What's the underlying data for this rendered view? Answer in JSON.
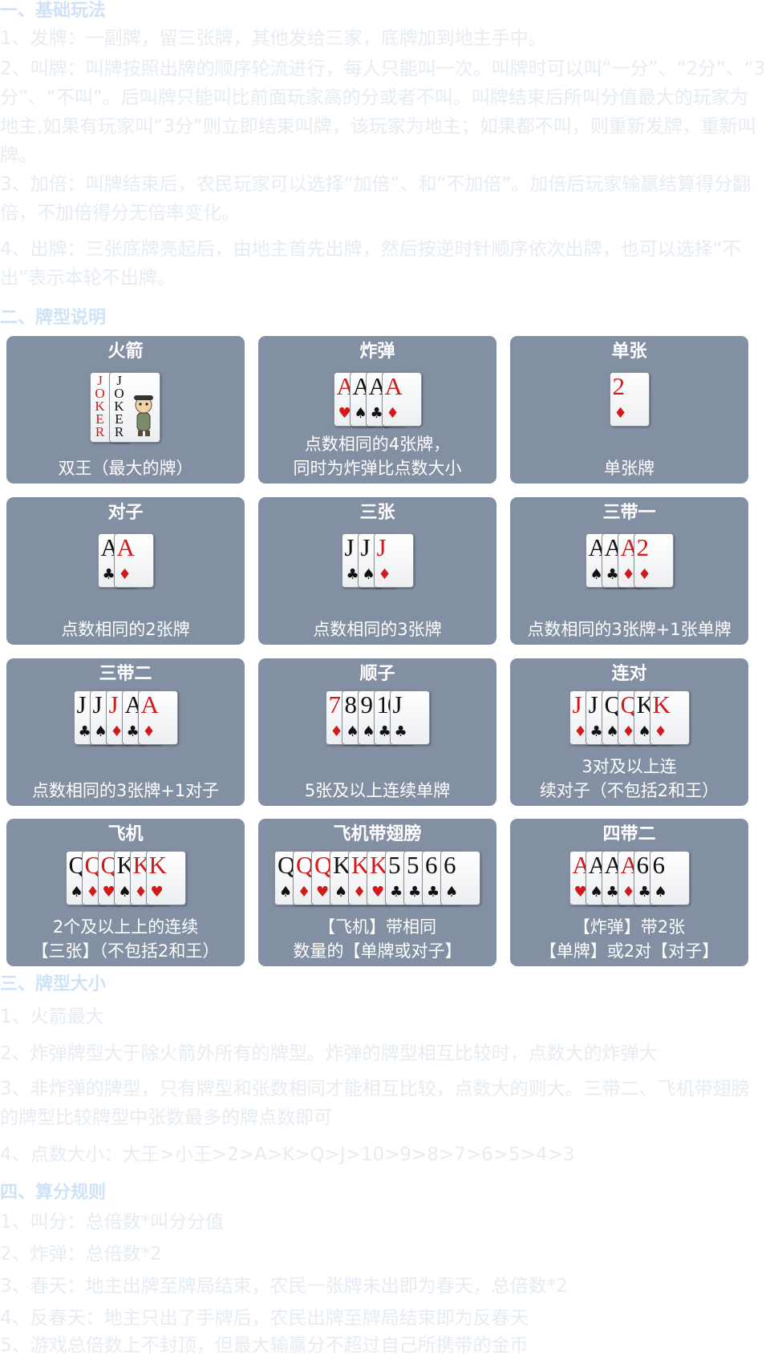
{
  "sections": {
    "s1": {
      "title": "一、基础玩法",
      "lines": [
        "1、发牌：一副牌，留三张牌，其他发给三家，底牌加到地主手中。",
        "2、叫牌：叫牌按照出牌的顺序轮流进行，每人只能叫一次。叫牌时可以叫“一分”、“2分”、“3分”、“不叫”。后叫牌只能叫比前面玩家高的分或者不叫。叫牌结束后所叫分值最大的玩家为地主,如果有玩家叫“3分”则立即结束叫牌，该玩家为地主；如果都不叫，则重新发牌，重新叫牌。",
        "3、加倍：叫牌结束后，农民玩家可以选择“加倍”、和“不加倍”。加倍后玩家输赢结算得分翻倍，不加倍得分无倍率变化。",
        "4、出牌：三张底牌亮起后，由地主首先出牌，然后按逆时针顺序依次出牌，也可以选择“不出”表示本轮不出牌。"
      ]
    },
    "s2": {
      "title": "二、牌型说明"
    },
    "s3": {
      "title": "三、牌型大小",
      "lines": [
        "1、火箭最大",
        "2、炸弹牌型大于除火箭外所有的牌型。炸弹的牌型相互比较时，点数大的炸弹大",
        "3、非炸弹的牌型，只有牌型和张数相同才能相互比较，点数大的则大。三带二、飞机带翅膀的牌型比较牌型中张数最多的牌点数即可",
        "4、点数大小：大王>小王>2>A>K>Q>J>10>9>8>7>6>5>4>3"
      ]
    },
    "s4": {
      "title": "四、算分规则",
      "lines": [
        "1、叫分：总倍数*叫分分值",
        "2、炸弹：总倍数*2",
        "3、春天：地主出牌至牌局结束，农民一张牌未出即为春天，总倍数*2",
        "4、反春天：地主只出了手牌后，农民出牌至牌局结束即为反春天",
        "5、游戏总倍数上不封顶，但最大输赢分不超过自己所携带的金币"
      ]
    }
  },
  "card_types": [
    {
      "name": "火箭",
      "desc": "双王（最大的牌）",
      "jokers": [
        {
          "text": "JOKER",
          "color": "red"
        },
        {
          "text": "JOKER",
          "color": "black"
        }
      ]
    },
    {
      "name": "炸弹",
      "desc": "点数相同的4张牌，\n同时为炸弹比点数大小",
      "cards": [
        [
          "A",
          "♥"
        ],
        [
          "A",
          "♠"
        ],
        [
          "A",
          "♣"
        ],
        [
          "A",
          "♦"
        ]
      ]
    },
    {
      "name": "单张",
      "desc": "单张牌",
      "cards": [
        [
          "2",
          "♦"
        ]
      ]
    },
    {
      "name": "对子",
      "desc": "点数相同的2张牌",
      "cards": [
        [
          "A",
          "♣"
        ],
        [
          "A",
          "♦"
        ]
      ]
    },
    {
      "name": "三张",
      "desc": "点数相同的3张牌",
      "cards": [
        [
          "J",
          "♣"
        ],
        [
          "J",
          "♠"
        ],
        [
          "J",
          "♦"
        ]
      ]
    },
    {
      "name": "三带一",
      "desc": "点数相同的3张牌+1张单牌",
      "cards": [
        [
          "A",
          "♠"
        ],
        [
          "A",
          "♣"
        ],
        [
          "A",
          "♦"
        ],
        [
          "2",
          "♦"
        ]
      ]
    },
    {
      "name": "三带二",
      "desc": "点数相同的3张牌+1对子",
      "cards": [
        [
          "J",
          "♣"
        ],
        [
          "J",
          "♠"
        ],
        [
          "J",
          "♦"
        ],
        [
          "A",
          "♣"
        ],
        [
          "A",
          "♦"
        ]
      ]
    },
    {
      "name": "顺子",
      "desc": "5张及以上连续单牌",
      "cards": [
        [
          "7",
          "♦"
        ],
        [
          "8",
          "♠"
        ],
        [
          "9",
          "♠"
        ],
        [
          "10",
          "♣"
        ],
        [
          "J",
          "♣"
        ]
      ]
    },
    {
      "name": "连对",
      "desc": "3对及以上连\n续对子（不包括2和王）",
      "cards": [
        [
          "J",
          "♦"
        ],
        [
          "J",
          "♣"
        ],
        [
          "Q",
          "♠"
        ],
        [
          "Q",
          "♦"
        ],
        [
          "K",
          "♠"
        ],
        [
          "K",
          "♦"
        ]
      ]
    },
    {
      "name": "飞机",
      "desc": "2个及以上上的连续\n【三张】（不包括2和王）",
      "cards": [
        [
          "Q",
          "♠"
        ],
        [
          "Q",
          "♦"
        ],
        [
          "Q",
          "♥"
        ],
        [
          "K",
          "♠"
        ],
        [
          "K",
          "♦"
        ],
        [
          "K",
          "♥"
        ]
      ]
    },
    {
      "name": "飞机带翅膀",
      "desc": "【飞机】带相同\n数量的【单牌或对子】",
      "cards": [
        [
          "Q",
          "♠"
        ],
        [
          "Q",
          "♦"
        ],
        [
          "Q",
          "♥"
        ],
        [
          "K",
          "♠"
        ],
        [
          "K",
          "♦"
        ],
        [
          "K",
          "♥"
        ],
        [
          "5",
          "♣"
        ],
        [
          "5",
          "♣"
        ],
        [
          "6",
          "♣"
        ],
        [
          "6",
          "♠"
        ]
      ]
    },
    {
      "name": "四带二",
      "desc": "【炸弹】带2张\n【单牌】或2对【对子】",
      "cards": [
        [
          "A",
          "♥"
        ],
        [
          "A",
          "♠"
        ],
        [
          "A",
          "♣"
        ],
        [
          "A",
          "♦"
        ],
        [
          "6",
          "♣"
        ],
        [
          "6",
          "♠"
        ]
      ]
    }
  ]
}
